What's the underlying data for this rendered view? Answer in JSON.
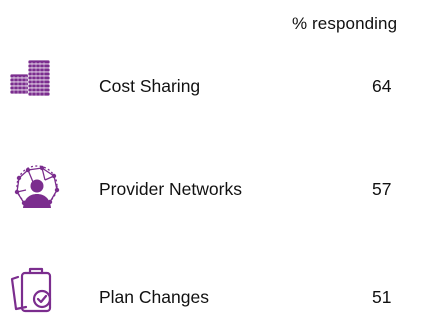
{
  "chart_data": {
    "type": "table",
    "header": "% responding",
    "rows": [
      {
        "icon": "coin-stack-icon",
        "label": "Cost Sharing",
        "value": 64
      },
      {
        "icon": "provider-network-icon",
        "label": "Provider Networks",
        "value": 57
      },
      {
        "icon": "clipboard-check-icon",
        "label": "Plan Changes",
        "value": 51
      }
    ]
  },
  "colors": {
    "accent": "#7B2D8E",
    "text": "#111111"
  }
}
